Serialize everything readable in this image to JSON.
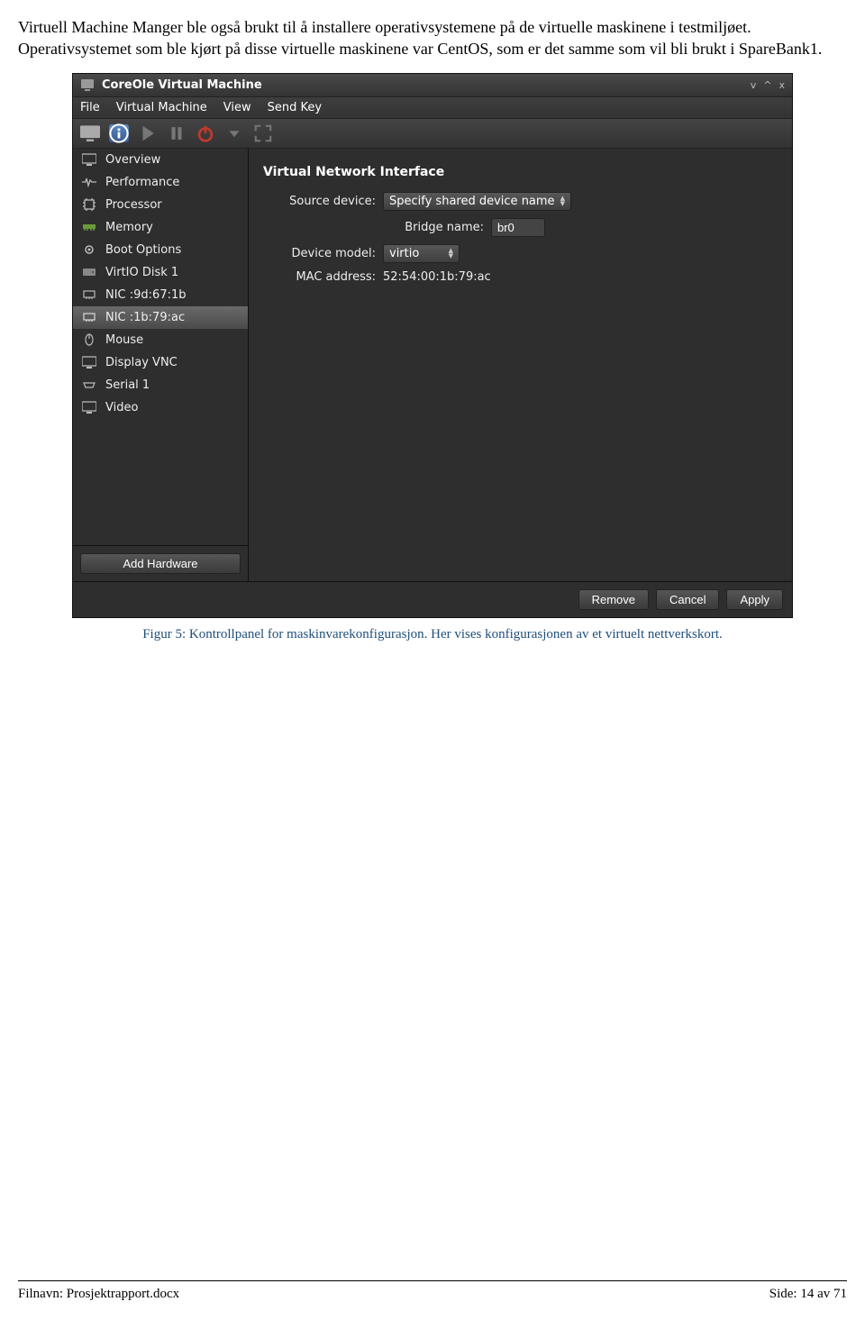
{
  "doc": {
    "para1": "Virtuell Machine Manger ble også brukt til å installere operativsystemene på de virtuelle maskinene i testmiljøet. Operativsystemet som ble kjørt på disse virtuelle maskinene var CentOS, som er det samme som vil bli brukt i SpareBank1.",
    "caption": "Figur 5: Kontrollpanel for maskinvarekonfigurasjon. Her vises konfigurasjonen av et virtuelt nettverkskort."
  },
  "vm": {
    "title": "CoreOle Virtual Machine",
    "menu": {
      "file": "File",
      "virtual_machine": "Virtual Machine",
      "view": "View",
      "send_key": "Send Key"
    },
    "sidebar": {
      "items": [
        {
          "label": "Overview",
          "icon": "monitor"
        },
        {
          "label": "Performance",
          "icon": "pulse"
        },
        {
          "label": "Processor",
          "icon": "cpu"
        },
        {
          "label": "Memory",
          "icon": "memory"
        },
        {
          "label": "Boot Options",
          "icon": "gear"
        },
        {
          "label": "VirtIO Disk 1",
          "icon": "disk"
        },
        {
          "label": "NIC :9d:67:1b",
          "icon": "nic"
        },
        {
          "label": "NIC :1b:79:ac",
          "icon": "nic"
        },
        {
          "label": "Mouse",
          "icon": "mouse"
        },
        {
          "label": "Display VNC",
          "icon": "monitor"
        },
        {
          "label": "Serial 1",
          "icon": "serial"
        },
        {
          "label": "Video",
          "icon": "monitor"
        }
      ],
      "selected_index": 7,
      "add_hardware": "Add Hardware"
    },
    "panel": {
      "title": "Virtual Network Interface",
      "source_device_label": "Source device:",
      "source_device_value": "Specify shared device name",
      "bridge_name_label": "Bridge name:",
      "bridge_name_value": "br0",
      "device_model_label": "Device model:",
      "device_model_value": "virtio",
      "mac_label": "MAC address:",
      "mac_value": "52:54:00:1b:79:ac"
    },
    "footer": {
      "remove": "Remove",
      "cancel": "Cancel",
      "apply": "Apply"
    }
  },
  "page_footer": {
    "left": "Filnavn: Prosjektrapport.docx",
    "right": "Side: 14 av 71"
  }
}
